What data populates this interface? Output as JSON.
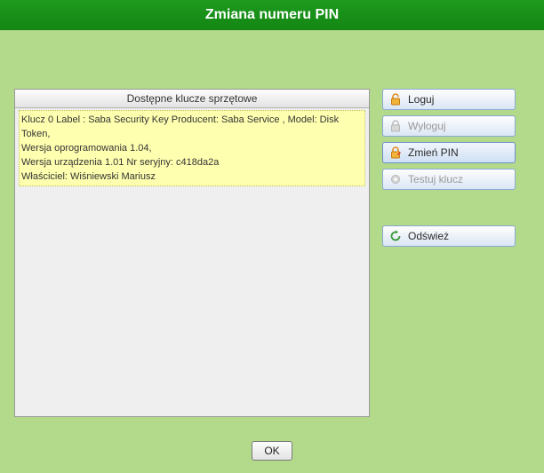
{
  "title": "Zmiana numeru PIN",
  "key_list": {
    "header": "Dostępne klucze sprzętowe",
    "items": [
      {
        "line1": "Klucz 0 Label : Saba Security Key Producent:  Saba Service , Model: Disk Token,",
        "line2": "Wersja oprogramowania 1.04,",
        "line3": "Wersja urządzenia 1.01 Nr seryjny: c418da2a",
        "line4": "Właściciel: Wiśniewski Mariusz"
      }
    ]
  },
  "buttons": {
    "login": "Loguj",
    "logout": "Wyloguj",
    "change_pin": "Zmień PIN",
    "test_key": "Testuj klucz",
    "refresh": "Odśwież",
    "ok": "OK"
  },
  "colors": {
    "header_bg": "#1a8b1a",
    "body_bg": "#b3d98b",
    "selected_item_bg": "#ffffb0",
    "button_border": "#8aa9d6"
  }
}
